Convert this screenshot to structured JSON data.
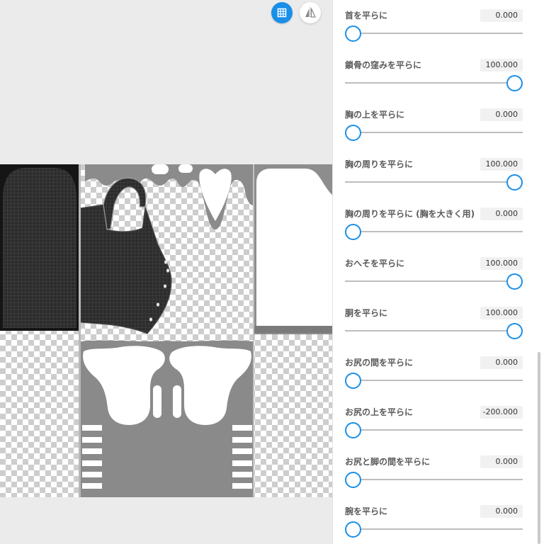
{
  "colors": {
    "accent": "#1a8fe8",
    "viewer_background": "#ebebeb",
    "panel_background": "#ffffff",
    "slider_track": "#bdbdbd"
  },
  "viewer": {
    "grid_button": {
      "icon": "grid-icon",
      "active": true
    },
    "mirror_button": {
      "icon": "mirror-icon",
      "active": false
    }
  },
  "settings": [
    {
      "label": "首を平らに",
      "value": "0.000",
      "slider_fraction": 0
    },
    {
      "label": "鎖骨の窪みを平らに",
      "value": "100.000",
      "slider_fraction": 1
    },
    {
      "label": "胸の上を平らに",
      "value": "0.000",
      "slider_fraction": 0
    },
    {
      "label": "胸の周りを平らに",
      "value": "100.000",
      "slider_fraction": 1
    },
    {
      "label": "胸の周りを平らに (胸を大きく用)",
      "value": "0.000",
      "slider_fraction": 0
    },
    {
      "label": "おへそを平らに",
      "value": "100.000",
      "slider_fraction": 1
    },
    {
      "label": "胴を平らに",
      "value": "100.000",
      "slider_fraction": 1
    },
    {
      "label": "お尻の間を平らに",
      "value": "0.000",
      "slider_fraction": 0
    },
    {
      "label": "お尻の上を平らに",
      "value": "-200.000",
      "slider_fraction": 0
    },
    {
      "label": "お尻と脚の間を平らに",
      "value": "0.000",
      "slider_fraction": 0
    },
    {
      "label": "腕を平らに",
      "value": "0.000",
      "slider_fraction": 0
    }
  ]
}
